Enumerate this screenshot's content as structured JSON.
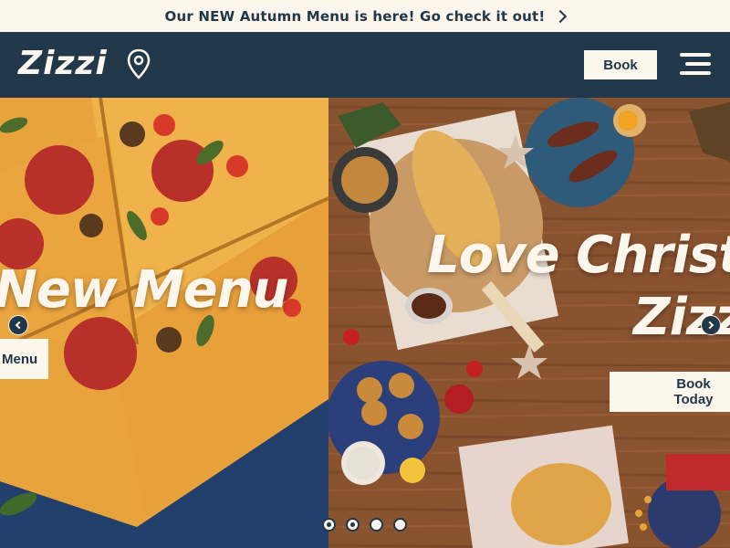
{
  "promo": {
    "text": "Our NEW Autumn Menu is here! Go check it out!",
    "icon": "chevron-right-icon"
  },
  "header": {
    "logo": "Zizzi",
    "location_icon": "map-pin-icon",
    "book_label": "Book",
    "menu_icon": "hamburger-menu-icon"
  },
  "hero": {
    "slides": [
      {
        "title": "New Menu",
        "button_label": "Menu"
      },
      {
        "title_line1": "Love Christ",
        "title_line2": "Zizzi",
        "button_label": "Book Today"
      }
    ],
    "prev_icon": "chevron-left-icon",
    "next_icon": "chevron-right-icon",
    "dots_count": 4,
    "active_dot": 2
  },
  "colors": {
    "navy": "#203849",
    "cream": "#fdf6ec"
  }
}
